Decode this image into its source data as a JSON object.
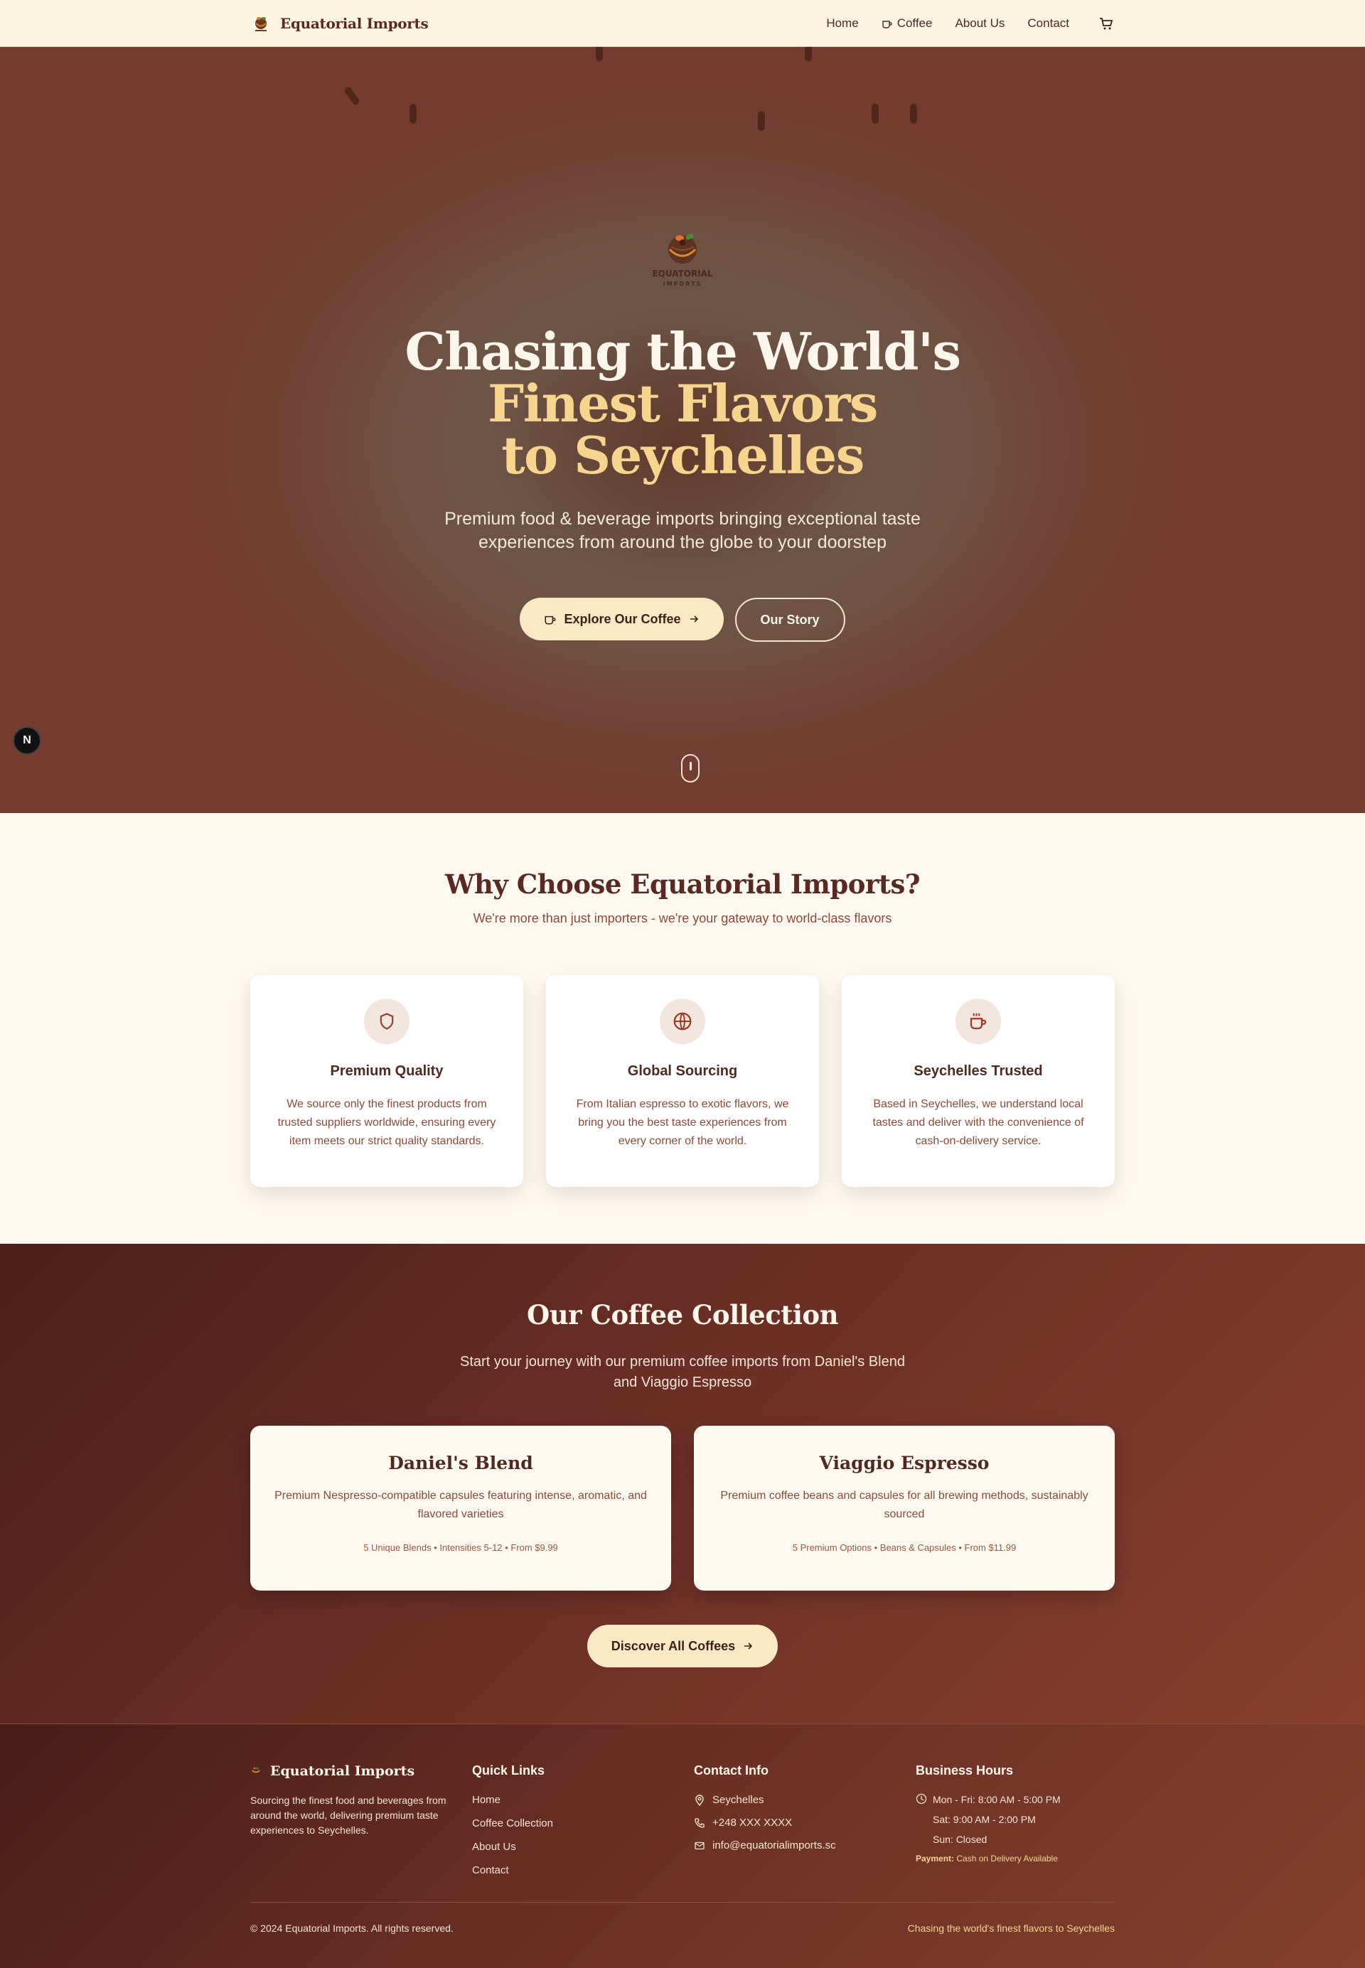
{
  "nav": {
    "brand": "Equatorial Imports",
    "links": [
      "Home",
      "Coffee",
      "About Us",
      "Contact"
    ]
  },
  "hero": {
    "logo_text_1": "EQUATORIAL",
    "logo_text_2": "IMPORTS",
    "title_line1": "Chasing the World's",
    "title_line2": "Finest Flavors",
    "title_line3": "to Seychelles",
    "subtitle": "Premium food & beverage imports bringing exceptional taste experiences from around the globe to your doorstep",
    "primary_button": "Explore Our Coffee",
    "secondary_button": "Our Story",
    "badge": "N"
  },
  "why": {
    "title": "Why Choose Equatorial Imports?",
    "subtitle": "We're more than just importers - we're your gateway to world-class flavors",
    "features": [
      {
        "icon": "shield-icon",
        "title": "Premium Quality",
        "text": "We source only the finest products from trusted suppliers worldwide, ensuring every item meets our strict quality standards."
      },
      {
        "icon": "globe-icon",
        "title": "Global Sourcing",
        "text": "From Italian espresso to exotic flavors, we bring you the best taste experiences from every corner of the world."
      },
      {
        "icon": "coffee-cup-icon",
        "title": "Seychelles Trusted",
        "text": "Based in Seychelles, we understand local tastes and deliver with the convenience of cash-on-delivery service."
      }
    ]
  },
  "collection": {
    "title": "Our Coffee Collection",
    "subtitle": "Start your journey with our premium coffee imports from Daniel's Blend and Viaggio Espresso",
    "products": [
      {
        "name": "Daniel's Blend",
        "desc": "Premium Nespresso-compatible capsules featuring intense, aromatic, and flavored varieties",
        "meta": "5 Unique Blends • Intensities 5-12 • From $9.99"
      },
      {
        "name": "Viaggio Espresso",
        "desc": "Premium coffee beans and capsules for all brewing methods, sustainably sourced",
        "meta": "5 Premium Options • Beans & Capsules • From $11.99"
      }
    ],
    "button": "Discover All Coffees"
  },
  "footer": {
    "brand": "Equatorial Imports",
    "description": "Sourcing the finest food and beverages from around the world, delivering premium taste experiences to Seychelles.",
    "quick_links_title": "Quick Links",
    "quick_links": [
      "Home",
      "Coffee Collection",
      "About Us",
      "Contact"
    ],
    "contact_title": "Contact Info",
    "contact": {
      "location": "Seychelles",
      "phone": "+248 XXX XXXX",
      "email": "info@equatorialimports.sc"
    },
    "hours_title": "Business Hours",
    "hours": [
      "Mon - Fri: 8:00 AM - 5:00 PM",
      "Sat: 9:00 AM - 2:00 PM",
      "Sun: Closed"
    ],
    "payment_label": "Payment:",
    "payment_value": "Cash on Delivery Available",
    "copyright": "© 2024 Equatorial Imports. All rights reserved.",
    "tagline": "Chasing the world's finest flavors to Seychelles"
  },
  "colors": {
    "brown_dark": "#5a2a22",
    "cream": "#fbe8c4",
    "gold": "#f6d58f",
    "page_bg": "#fdf9f1"
  }
}
